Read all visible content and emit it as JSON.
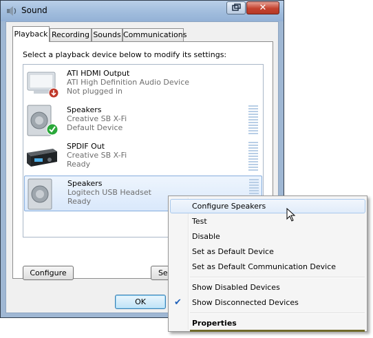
{
  "window": {
    "title": "Sound",
    "close_label": "✕"
  },
  "tabs": [
    {
      "label": "Playback"
    },
    {
      "label": "Recording"
    },
    {
      "label": "Sounds"
    },
    {
      "label": "Communications"
    }
  ],
  "panel": {
    "instruction": "Select a playback device below to modify its settings:"
  },
  "devices": [
    {
      "name": "ATI HDMI Output",
      "sub": "ATI High Definition Audio Device",
      "status": "Not plugged in",
      "icon": "monitor-icon",
      "badge": "unplugged-badge-icon",
      "has_level": false
    },
    {
      "name": "Speakers",
      "sub": "Creative SB X-Fi",
      "status": "Default Device",
      "icon": "speaker-icon",
      "badge": "default-check-badge-icon",
      "has_level": true
    },
    {
      "name": "SPDIF Out",
      "sub": "Creative SB X-Fi",
      "status": "Ready",
      "icon": "receiver-icon",
      "badge": "",
      "has_level": true
    },
    {
      "name": "Speakers",
      "sub": "Logitech USB Headset",
      "status": "Ready",
      "icon": "speaker-icon",
      "badge": "",
      "has_level": true,
      "selected": true
    }
  ],
  "buttons": {
    "configure": "Configure",
    "set_default": "Set",
    "ok": "OK"
  },
  "context_menu": {
    "items": [
      {
        "label": "Configure Speakers",
        "hover": true
      },
      {
        "label": "Test"
      },
      {
        "label": "Disable"
      },
      {
        "label": "Set as Default Device"
      },
      {
        "label": "Set as Default Communication Device"
      },
      {
        "label": "Show Disabled Devices"
      },
      {
        "label": "Show Disconnected Devices",
        "checked": true
      },
      {
        "label": "Properties",
        "bold": true
      }
    ],
    "check_glyph": "✔"
  },
  "colors": {
    "selection": "#d9e8fb",
    "close": "#c4422f",
    "check": "#1c5fb8"
  }
}
